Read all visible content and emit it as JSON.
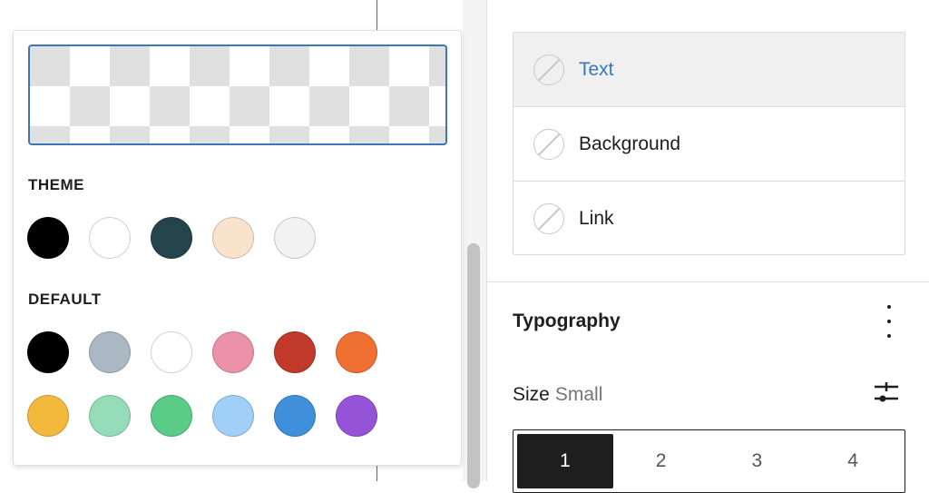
{
  "color_picker": {
    "theme_label": "THEME",
    "default_label": "DEFAULT",
    "theme_colors": [
      "#000000",
      "#ffffff",
      "#24434a",
      "#f9e3cc",
      "#f2f2f2"
    ],
    "default_colors": [
      "#000000",
      "#abb8c3",
      "#ffffff",
      "#eb91a8",
      "#c0392b",
      "#ef7030",
      "#f2b93c",
      "#94dcb7",
      "#5bcb88",
      "#a0cff8",
      "#3f8fdb",
      "#9554d8"
    ],
    "preview_selected": "transparent"
  },
  "colors_panel": {
    "items": [
      {
        "label": "Text",
        "active": true
      },
      {
        "label": "Background",
        "active": false
      },
      {
        "label": "Link",
        "active": false
      }
    ]
  },
  "typography": {
    "title": "Typography",
    "size_label": "Size",
    "size_value": "Small",
    "sizes": [
      "1",
      "2",
      "3",
      "4"
    ],
    "active_size": "1"
  },
  "colors": {
    "accent": "#3b78b8",
    "active_item_bg": "#f0f0f0"
  }
}
